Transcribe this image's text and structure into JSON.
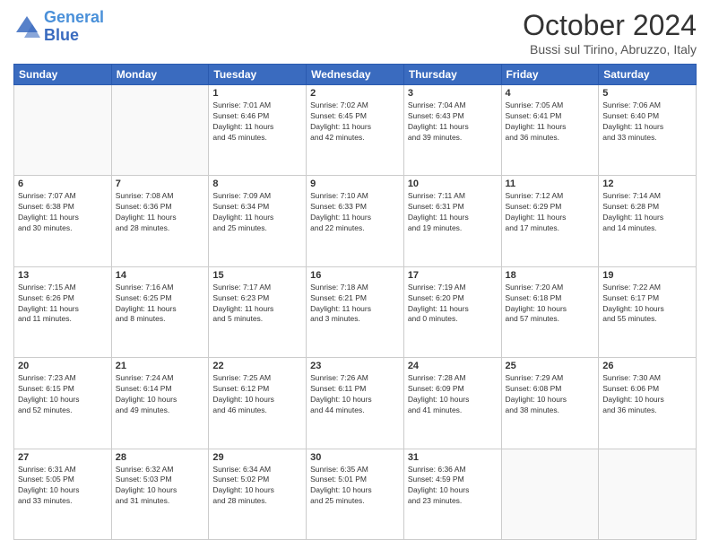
{
  "logo": {
    "line1": "General",
    "line2": "Blue"
  },
  "title": "October 2024",
  "location": "Bussi sul Tirino, Abruzzo, Italy",
  "days_header": [
    "Sunday",
    "Monday",
    "Tuesday",
    "Wednesday",
    "Thursday",
    "Friday",
    "Saturday"
  ],
  "weeks": [
    [
      {
        "day": "",
        "info": ""
      },
      {
        "day": "",
        "info": ""
      },
      {
        "day": "1",
        "info": "Sunrise: 7:01 AM\nSunset: 6:46 PM\nDaylight: 11 hours\nand 45 minutes."
      },
      {
        "day": "2",
        "info": "Sunrise: 7:02 AM\nSunset: 6:45 PM\nDaylight: 11 hours\nand 42 minutes."
      },
      {
        "day": "3",
        "info": "Sunrise: 7:04 AM\nSunset: 6:43 PM\nDaylight: 11 hours\nand 39 minutes."
      },
      {
        "day": "4",
        "info": "Sunrise: 7:05 AM\nSunset: 6:41 PM\nDaylight: 11 hours\nand 36 minutes."
      },
      {
        "day": "5",
        "info": "Sunrise: 7:06 AM\nSunset: 6:40 PM\nDaylight: 11 hours\nand 33 minutes."
      }
    ],
    [
      {
        "day": "6",
        "info": "Sunrise: 7:07 AM\nSunset: 6:38 PM\nDaylight: 11 hours\nand 30 minutes."
      },
      {
        "day": "7",
        "info": "Sunrise: 7:08 AM\nSunset: 6:36 PM\nDaylight: 11 hours\nand 28 minutes."
      },
      {
        "day": "8",
        "info": "Sunrise: 7:09 AM\nSunset: 6:34 PM\nDaylight: 11 hours\nand 25 minutes."
      },
      {
        "day": "9",
        "info": "Sunrise: 7:10 AM\nSunset: 6:33 PM\nDaylight: 11 hours\nand 22 minutes."
      },
      {
        "day": "10",
        "info": "Sunrise: 7:11 AM\nSunset: 6:31 PM\nDaylight: 11 hours\nand 19 minutes."
      },
      {
        "day": "11",
        "info": "Sunrise: 7:12 AM\nSunset: 6:29 PM\nDaylight: 11 hours\nand 17 minutes."
      },
      {
        "day": "12",
        "info": "Sunrise: 7:14 AM\nSunset: 6:28 PM\nDaylight: 11 hours\nand 14 minutes."
      }
    ],
    [
      {
        "day": "13",
        "info": "Sunrise: 7:15 AM\nSunset: 6:26 PM\nDaylight: 11 hours\nand 11 minutes."
      },
      {
        "day": "14",
        "info": "Sunrise: 7:16 AM\nSunset: 6:25 PM\nDaylight: 11 hours\nand 8 minutes."
      },
      {
        "day": "15",
        "info": "Sunrise: 7:17 AM\nSunset: 6:23 PM\nDaylight: 11 hours\nand 5 minutes."
      },
      {
        "day": "16",
        "info": "Sunrise: 7:18 AM\nSunset: 6:21 PM\nDaylight: 11 hours\nand 3 minutes."
      },
      {
        "day": "17",
        "info": "Sunrise: 7:19 AM\nSunset: 6:20 PM\nDaylight: 11 hours\nand 0 minutes."
      },
      {
        "day": "18",
        "info": "Sunrise: 7:20 AM\nSunset: 6:18 PM\nDaylight: 10 hours\nand 57 minutes."
      },
      {
        "day": "19",
        "info": "Sunrise: 7:22 AM\nSunset: 6:17 PM\nDaylight: 10 hours\nand 55 minutes."
      }
    ],
    [
      {
        "day": "20",
        "info": "Sunrise: 7:23 AM\nSunset: 6:15 PM\nDaylight: 10 hours\nand 52 minutes."
      },
      {
        "day": "21",
        "info": "Sunrise: 7:24 AM\nSunset: 6:14 PM\nDaylight: 10 hours\nand 49 minutes."
      },
      {
        "day": "22",
        "info": "Sunrise: 7:25 AM\nSunset: 6:12 PM\nDaylight: 10 hours\nand 46 minutes."
      },
      {
        "day": "23",
        "info": "Sunrise: 7:26 AM\nSunset: 6:11 PM\nDaylight: 10 hours\nand 44 minutes."
      },
      {
        "day": "24",
        "info": "Sunrise: 7:28 AM\nSunset: 6:09 PM\nDaylight: 10 hours\nand 41 minutes."
      },
      {
        "day": "25",
        "info": "Sunrise: 7:29 AM\nSunset: 6:08 PM\nDaylight: 10 hours\nand 38 minutes."
      },
      {
        "day": "26",
        "info": "Sunrise: 7:30 AM\nSunset: 6:06 PM\nDaylight: 10 hours\nand 36 minutes."
      }
    ],
    [
      {
        "day": "27",
        "info": "Sunrise: 6:31 AM\nSunset: 5:05 PM\nDaylight: 10 hours\nand 33 minutes."
      },
      {
        "day": "28",
        "info": "Sunrise: 6:32 AM\nSunset: 5:03 PM\nDaylight: 10 hours\nand 31 minutes."
      },
      {
        "day": "29",
        "info": "Sunrise: 6:34 AM\nSunset: 5:02 PM\nDaylight: 10 hours\nand 28 minutes."
      },
      {
        "day": "30",
        "info": "Sunrise: 6:35 AM\nSunset: 5:01 PM\nDaylight: 10 hours\nand 25 minutes."
      },
      {
        "day": "31",
        "info": "Sunrise: 6:36 AM\nSunset: 4:59 PM\nDaylight: 10 hours\nand 23 minutes."
      },
      {
        "day": "",
        "info": ""
      },
      {
        "day": "",
        "info": ""
      }
    ]
  ]
}
